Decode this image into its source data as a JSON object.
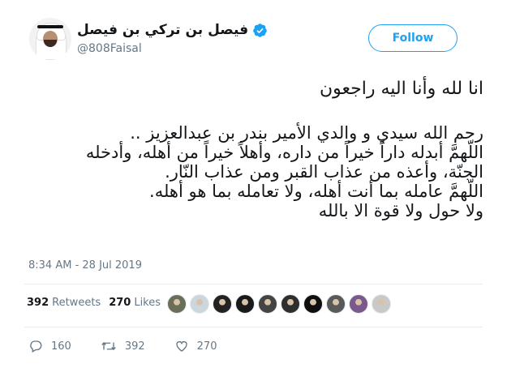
{
  "header": {
    "display_name": "فيصل بن تركي بن فيصل",
    "handle": "@808Faisal",
    "follow_label": "Follow",
    "accent_color": "#1da1f2",
    "verified": true
  },
  "tweet": {
    "lines": [
      "انا لله وأنا اليه راجعون",
      "رحم الله سيدي و والدي الأمير بندر بن عبدالعزيز ..",
      "اللّهمَّ أبدله داراً خيراً من داره، وأهلاً خيراً من أهله، وأدخله",
      "الجنّة، وأعذه من عذاب القبر ومن عذاب النّار.",
      "اللّهمَّ عامله بما أنت أهله، ولا تعامله بما هو أهله.",
      "ولا حول ولا قوة الا بالله"
    ],
    "timestamp": "8:34 AM - 28 Jul 2019"
  },
  "stats": {
    "retweets_count": "392",
    "retweets_label": "Retweets",
    "likes_count": "270",
    "likes_label": "Likes"
  },
  "liker_avatars": [
    {
      "icon": "airplane-avatar-icon",
      "color": "#6b6f5a"
    },
    {
      "icon": "default-avatar-icon",
      "color": "#ccd6dd"
    },
    {
      "icon": "emblem-avatar-icon",
      "color": "#222222"
    },
    {
      "icon": "gold-emblem-avatar-icon",
      "color": "#1a1a1a"
    },
    {
      "icon": "person-avatar-icon",
      "color": "#444444"
    },
    {
      "icon": "portrait-avatar-icon",
      "color": "#2e2e2e"
    },
    {
      "icon": "art-avatar-icon",
      "color": "#0f0f0f"
    },
    {
      "icon": "group-avatar-icon",
      "color": "#5a5a5a"
    },
    {
      "icon": "figure-avatar-icon",
      "color": "#7a5a8a"
    },
    {
      "icon": "man-avatar-icon",
      "color": "#c9c9c9"
    }
  ],
  "actions": {
    "reply_count": "160",
    "retweet_count": "392",
    "like_count": "270"
  }
}
